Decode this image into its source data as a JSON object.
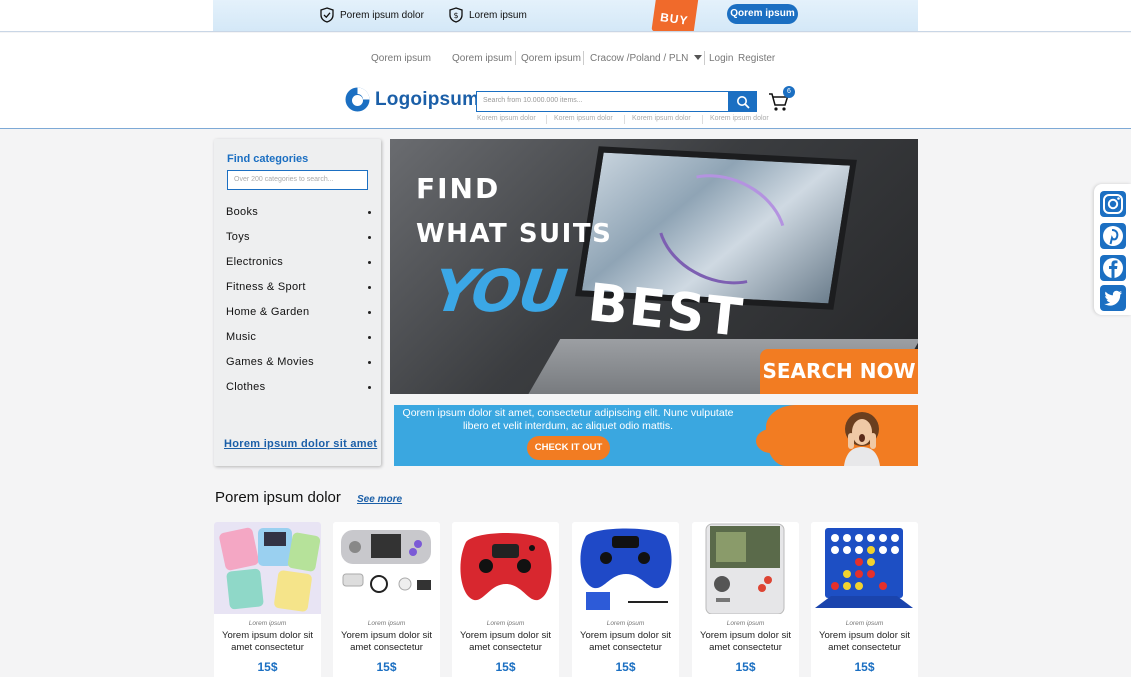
{
  "promo": {
    "item1": "Porem ipsum dolor",
    "item2": "Lorem ipsum",
    "buy_tag": "BUY",
    "button": "Qorem ipsum"
  },
  "topnav": {
    "links": [
      "Qorem ipsum",
      "Qorem ipsum",
      "Qorem ipsum"
    ],
    "region": "Cracow /Poland / PLN",
    "login": "Login",
    "register": "Register"
  },
  "header": {
    "logo": "Logoipsum",
    "search_placeholder": "Search from 10.000.000 items...",
    "cart_count": "6",
    "suggestions": [
      "Korem ipsum dolor",
      "Korem ipsum dolor",
      "Korem ipsum dolor",
      "Korem ipsum dolor"
    ]
  },
  "sidebar": {
    "title": "Find categories",
    "search_placeholder": "Over 200 categories to search...",
    "categories": [
      "Books",
      "Toys",
      "Electronics",
      "Fitness & Sport",
      "Home & Garden",
      "Music",
      "Games & Movies",
      "Clothes"
    ],
    "link": "Horem ipsum dolor sit amet"
  },
  "hero": {
    "line1": "FIND",
    "line2": "WHAT SUITS",
    "you": "YOU",
    "best": "BEST",
    "cta": "SEARCH NOW"
  },
  "banner": {
    "text": "Qorem ipsum dolor sit amet, consectetur adipiscing elit. Nunc vulputate libero et velit interdum, ac aliquet odio mattis.",
    "button": "CHECK IT OUT"
  },
  "section": {
    "title": "Porem ipsum dolor",
    "link": "See more"
  },
  "products": [
    {
      "category": "Lorem ipsum",
      "name": "Yorem ipsum dolor sit amet consectetur",
      "price": "15$"
    },
    {
      "category": "Lorem ipsum",
      "name": "Yorem ipsum dolor sit amet consectetur",
      "price": "15$"
    },
    {
      "category": "Lorem ipsum",
      "name": "Yorem ipsum dolor sit amet consectetur",
      "price": "15$"
    },
    {
      "category": "Lorem ipsum",
      "name": "Yorem ipsum dolor sit amet consectetur",
      "price": "15$"
    },
    {
      "category": "Lorem ipsum",
      "name": "Yorem ipsum dolor sit amet consectetur",
      "price": "15$"
    },
    {
      "category": "Lorem ipsum",
      "name": "Yorem ipsum dolor sit amet consectetur",
      "price": "15$"
    }
  ],
  "social": [
    "instagram-icon",
    "pinterest-icon",
    "facebook-icon",
    "twitter-icon"
  ],
  "colors": {
    "brand": "#1b6fc2",
    "accent": "#f27c22",
    "sky": "#3aa7e0"
  }
}
